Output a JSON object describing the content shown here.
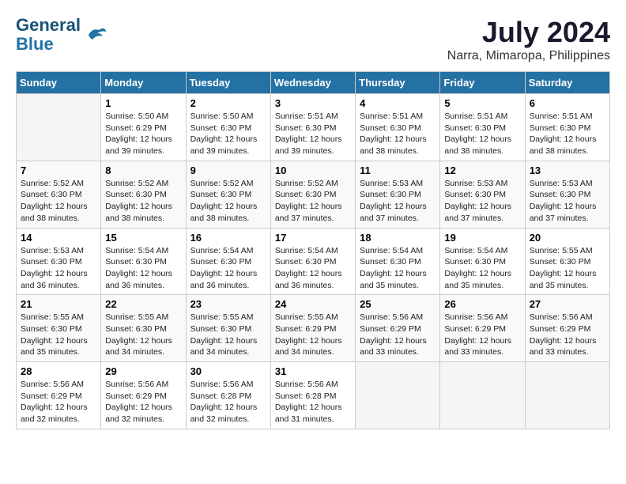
{
  "logo": {
    "line1": "General",
    "line2": "Blue"
  },
  "title": "July 2024",
  "subtitle": "Narra, Mimaropa, Philippines",
  "weekdays": [
    "Sunday",
    "Monday",
    "Tuesday",
    "Wednesday",
    "Thursday",
    "Friday",
    "Saturday"
  ],
  "weeks": [
    [
      {
        "day": "",
        "content": ""
      },
      {
        "day": "1",
        "content": "Sunrise: 5:50 AM\nSunset: 6:29 PM\nDaylight: 12 hours\nand 39 minutes."
      },
      {
        "day": "2",
        "content": "Sunrise: 5:50 AM\nSunset: 6:30 PM\nDaylight: 12 hours\nand 39 minutes."
      },
      {
        "day": "3",
        "content": "Sunrise: 5:51 AM\nSunset: 6:30 PM\nDaylight: 12 hours\nand 39 minutes."
      },
      {
        "day": "4",
        "content": "Sunrise: 5:51 AM\nSunset: 6:30 PM\nDaylight: 12 hours\nand 38 minutes."
      },
      {
        "day": "5",
        "content": "Sunrise: 5:51 AM\nSunset: 6:30 PM\nDaylight: 12 hours\nand 38 minutes."
      },
      {
        "day": "6",
        "content": "Sunrise: 5:51 AM\nSunset: 6:30 PM\nDaylight: 12 hours\nand 38 minutes."
      }
    ],
    [
      {
        "day": "7",
        "content": "Sunrise: 5:52 AM\nSunset: 6:30 PM\nDaylight: 12 hours\nand 38 minutes."
      },
      {
        "day": "8",
        "content": "Sunrise: 5:52 AM\nSunset: 6:30 PM\nDaylight: 12 hours\nand 38 minutes."
      },
      {
        "day": "9",
        "content": "Sunrise: 5:52 AM\nSunset: 6:30 PM\nDaylight: 12 hours\nand 38 minutes."
      },
      {
        "day": "10",
        "content": "Sunrise: 5:52 AM\nSunset: 6:30 PM\nDaylight: 12 hours\nand 37 minutes."
      },
      {
        "day": "11",
        "content": "Sunrise: 5:53 AM\nSunset: 6:30 PM\nDaylight: 12 hours\nand 37 minutes."
      },
      {
        "day": "12",
        "content": "Sunrise: 5:53 AM\nSunset: 6:30 PM\nDaylight: 12 hours\nand 37 minutes."
      },
      {
        "day": "13",
        "content": "Sunrise: 5:53 AM\nSunset: 6:30 PM\nDaylight: 12 hours\nand 37 minutes."
      }
    ],
    [
      {
        "day": "14",
        "content": "Sunrise: 5:53 AM\nSunset: 6:30 PM\nDaylight: 12 hours\nand 36 minutes."
      },
      {
        "day": "15",
        "content": "Sunrise: 5:54 AM\nSunset: 6:30 PM\nDaylight: 12 hours\nand 36 minutes."
      },
      {
        "day": "16",
        "content": "Sunrise: 5:54 AM\nSunset: 6:30 PM\nDaylight: 12 hours\nand 36 minutes."
      },
      {
        "day": "17",
        "content": "Sunrise: 5:54 AM\nSunset: 6:30 PM\nDaylight: 12 hours\nand 36 minutes."
      },
      {
        "day": "18",
        "content": "Sunrise: 5:54 AM\nSunset: 6:30 PM\nDaylight: 12 hours\nand 35 minutes."
      },
      {
        "day": "19",
        "content": "Sunrise: 5:54 AM\nSunset: 6:30 PM\nDaylight: 12 hours\nand 35 minutes."
      },
      {
        "day": "20",
        "content": "Sunrise: 5:55 AM\nSunset: 6:30 PM\nDaylight: 12 hours\nand 35 minutes."
      }
    ],
    [
      {
        "day": "21",
        "content": "Sunrise: 5:55 AM\nSunset: 6:30 PM\nDaylight: 12 hours\nand 35 minutes."
      },
      {
        "day": "22",
        "content": "Sunrise: 5:55 AM\nSunset: 6:30 PM\nDaylight: 12 hours\nand 34 minutes."
      },
      {
        "day": "23",
        "content": "Sunrise: 5:55 AM\nSunset: 6:30 PM\nDaylight: 12 hours\nand 34 minutes."
      },
      {
        "day": "24",
        "content": "Sunrise: 5:55 AM\nSunset: 6:29 PM\nDaylight: 12 hours\nand 34 minutes."
      },
      {
        "day": "25",
        "content": "Sunrise: 5:56 AM\nSunset: 6:29 PM\nDaylight: 12 hours\nand 33 minutes."
      },
      {
        "day": "26",
        "content": "Sunrise: 5:56 AM\nSunset: 6:29 PM\nDaylight: 12 hours\nand 33 minutes."
      },
      {
        "day": "27",
        "content": "Sunrise: 5:56 AM\nSunset: 6:29 PM\nDaylight: 12 hours\nand 33 minutes."
      }
    ],
    [
      {
        "day": "28",
        "content": "Sunrise: 5:56 AM\nSunset: 6:29 PM\nDaylight: 12 hours\nand 32 minutes."
      },
      {
        "day": "29",
        "content": "Sunrise: 5:56 AM\nSunset: 6:29 PM\nDaylight: 12 hours\nand 32 minutes."
      },
      {
        "day": "30",
        "content": "Sunrise: 5:56 AM\nSunset: 6:28 PM\nDaylight: 12 hours\nand 32 minutes."
      },
      {
        "day": "31",
        "content": "Sunrise: 5:56 AM\nSunset: 6:28 PM\nDaylight: 12 hours\nand 31 minutes."
      },
      {
        "day": "",
        "content": ""
      },
      {
        "day": "",
        "content": ""
      },
      {
        "day": "",
        "content": ""
      }
    ]
  ]
}
